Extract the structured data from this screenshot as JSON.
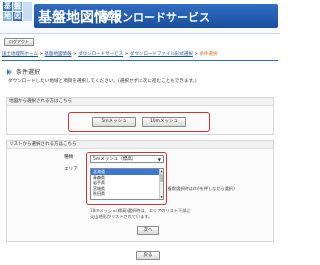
{
  "header": {
    "logo_chars": [
      "基",
      "盤",
      "地",
      "図"
    ],
    "brand_title": "基盤地図情報",
    "brand_subtitle": "ダウンロードサービス"
  },
  "logout_label": "ログアウト",
  "breadcrumb": {
    "items": [
      "国土地理院ホーム",
      "基盤地図情報",
      "ダウンロードサービス",
      "ダウンロードファイル形式選択"
    ],
    "separator": ">",
    "current": "条件選択"
  },
  "section": {
    "title": "条件選択",
    "description": "ダウンロードしたい地域と項目を選択してください。(選択せずに次に進むこともできます。)"
  },
  "map_panel": {
    "heading": "地図から選択される方はこちら",
    "buttons": [
      "5mメッシュ",
      "10mメッシュ"
    ]
  },
  "list_panel": {
    "heading": "リストから選択される方はこちら",
    "type_label": "種類",
    "type_value": "5mメッシュ（標高）",
    "area_label": "エリア",
    "area_options": [
      "北海道",
      "青森県",
      "岩手県",
      "宮城県",
      "秋田県"
    ],
    "area_selected_index": 0,
    "multi_select_hint": "(複数選択時はctrlを押しながら選択)",
    "note_line1": "10mメッシュ(標高)選択時は、エリアのリスト下部に",
    "note_line2": "火山地形がリストされています。",
    "next_button": "次へ"
  },
  "back_button": "戻る",
  "colors": {
    "brand_blue": "#1a4f9e",
    "highlight_red": "#d0352b",
    "current_crumb": "#d36a1a",
    "selected_option": "#3b78d6"
  }
}
